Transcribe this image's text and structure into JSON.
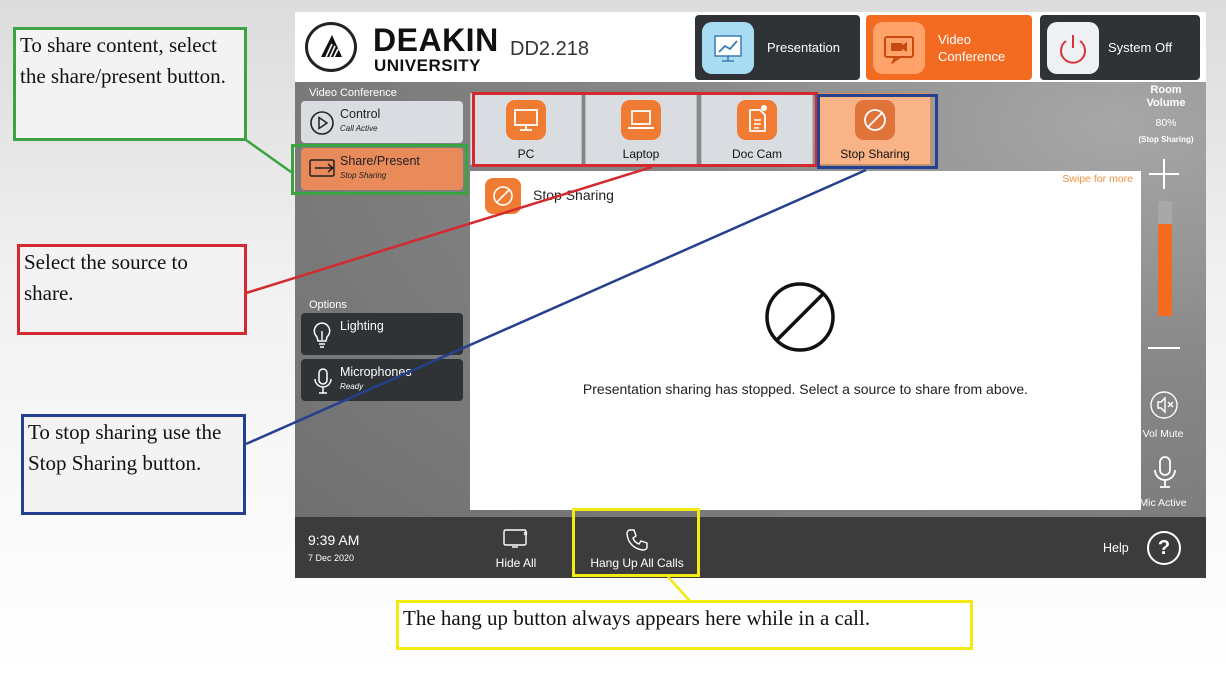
{
  "header": {
    "brand_line1": "DEAKIN",
    "brand_line2": "UNIVERSITY",
    "room": "DD2.218",
    "modes": [
      {
        "label": "Presentation"
      },
      {
        "label": "Video\nConference"
      },
      {
        "label": "System Off"
      }
    ]
  },
  "sidebar": {
    "section1": "Video Conference",
    "items": [
      {
        "label": "Control",
        "sub": "Call Active"
      },
      {
        "label": "Share/Present",
        "sub": "Stop Sharing"
      }
    ],
    "section2": "Options",
    "options": [
      {
        "label": "Lighting",
        "sub": ""
      },
      {
        "label": "Microphones",
        "sub": "Ready"
      }
    ]
  },
  "sources": [
    {
      "label": "PC"
    },
    {
      "label": "Laptop"
    },
    {
      "label": "Doc Cam"
    },
    {
      "label": "Stop Sharing"
    }
  ],
  "content": {
    "swipe_hint": "Swipe for more",
    "title": "Stop Sharing",
    "message": "Presentation sharing has stopped. Select a source to share from above."
  },
  "volume": {
    "title": "Room\nVolume",
    "level_text": "80%",
    "level": 0.8,
    "status": "(Stop Sharing)",
    "mute_label": "Vol Mute",
    "mic_label": "Mic Active"
  },
  "footer": {
    "time": "9:39 AM",
    "date": "7 Dec 2020",
    "hide_all": "Hide All",
    "hang_up": "Hang Up All Calls",
    "help": "Help",
    "help_symbol": "?"
  },
  "callouts": {
    "green": "To share content, select the share/present button.",
    "red": "Select the source to share.",
    "blue": "To stop sharing use the Stop Sharing button.",
    "yellow": "The hang up button always appears here while in a call."
  },
  "colors": {
    "accent_orange": "#f07b33",
    "dark_button": "#2f3336",
    "green_outline": "#3aa441",
    "red_outline": "#d42a2f",
    "blue_outline": "#24408e",
    "yellow_outline": "#f3ea12"
  }
}
